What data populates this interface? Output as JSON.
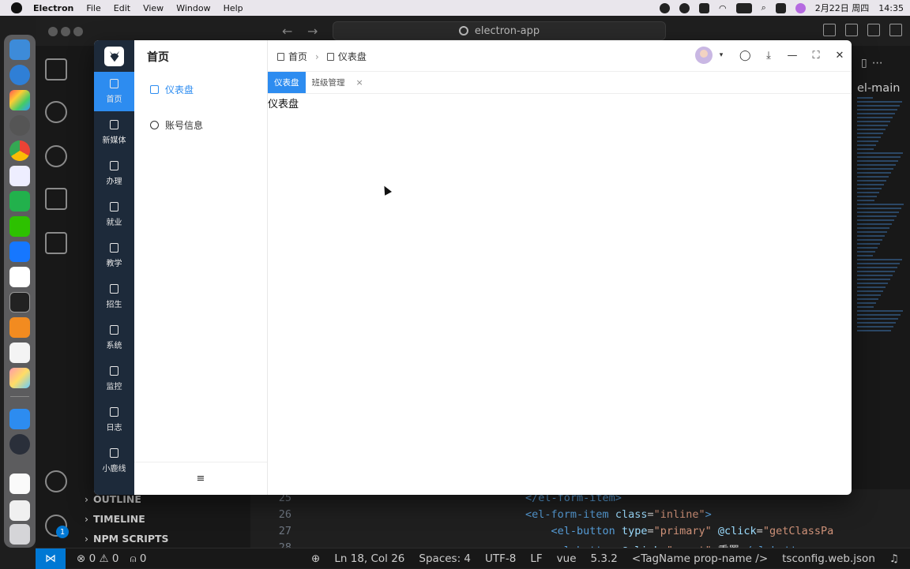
{
  "menubar": {
    "app_name": "Electron",
    "items": [
      "File",
      "Edit",
      "View",
      "Window",
      "Help"
    ],
    "date": "2月22日 周四",
    "time": "14:35"
  },
  "vscode": {
    "command_center": "electron-app",
    "editor_tab_partial": "el-main",
    "side_sections": [
      "OUTLINE",
      "TIMELINE",
      "NPM SCRIPTS"
    ],
    "settings_badge": "1",
    "code_lines": [
      {
        "num": "25",
        "html": "<span class=\"tag\">&lt;/el-form-item&gt;</span>"
      },
      {
        "num": "26",
        "html": "<span class=\"tag\">&lt;el-form-item</span> <span class=\"attr\">class</span>=<span class=\"str\">\"inline\"</span><span class=\"tag\">&gt;</span>"
      },
      {
        "num": "27",
        "html": "    <span class=\"tag\">&lt;el-button</span> <span class=\"attr\">type</span>=<span class=\"str\">\"primary\"</span> <span class=\"attr\">@click</span>=<span class=\"str\">\"getClassPa</span>"
      },
      {
        "num": "28",
        "html": "    <span class=\"tag\">&lt;el-button</span> <span class=\"attr\">@click</span>=<span class=\"str\">\"reset\"</span>&gt;重置<span class=\"tag\">&lt;/el-button&gt;</span>"
      }
    ],
    "status": {
      "errors": "0",
      "warnings": "0",
      "ports": "0",
      "cursor": "Ln 18, Col 26",
      "spaces": "Spaces: 4",
      "encoding": "UTF-8",
      "eol": "LF",
      "language": "vue",
      "version": "5.3.2",
      "tag_name": "<TagName prop-name />",
      "tsconfig": "tsconfig.web.json"
    }
  },
  "app": {
    "rail_items": [
      {
        "label": "首页",
        "icon": "copy-icon"
      },
      {
        "label": "新媒体",
        "icon": "tablet-icon"
      },
      {
        "label": "办理",
        "icon": "edit-icon"
      },
      {
        "label": "就业",
        "icon": "user-icon"
      },
      {
        "label": "教学",
        "icon": "tablet-icon"
      },
      {
        "label": "招生",
        "icon": "headset-icon"
      },
      {
        "label": "系统",
        "icon": "gear-icon"
      },
      {
        "label": "监控",
        "icon": "monitor-icon"
      },
      {
        "label": "日志",
        "icon": "log-icon"
      },
      {
        "label": "小鹿线",
        "icon": "home-icon"
      }
    ],
    "submenu": {
      "title": "首页",
      "items": [
        {
          "label": "仪表盘",
          "icon": "home-icon"
        },
        {
          "label": "账号信息",
          "icon": "user-icon"
        }
      ],
      "footer_icon": "≡"
    },
    "breadcrumb": [
      "首页",
      "仪表盘"
    ],
    "tabs": [
      {
        "label": "仪表盘",
        "closable": false
      },
      {
        "label": "班级管理",
        "closable": true
      }
    ],
    "tab_close": "×",
    "page_text": "仪表盘",
    "colors": {
      "accent": "#2d8cf0",
      "rail_bg": "#1d2a3a"
    }
  }
}
